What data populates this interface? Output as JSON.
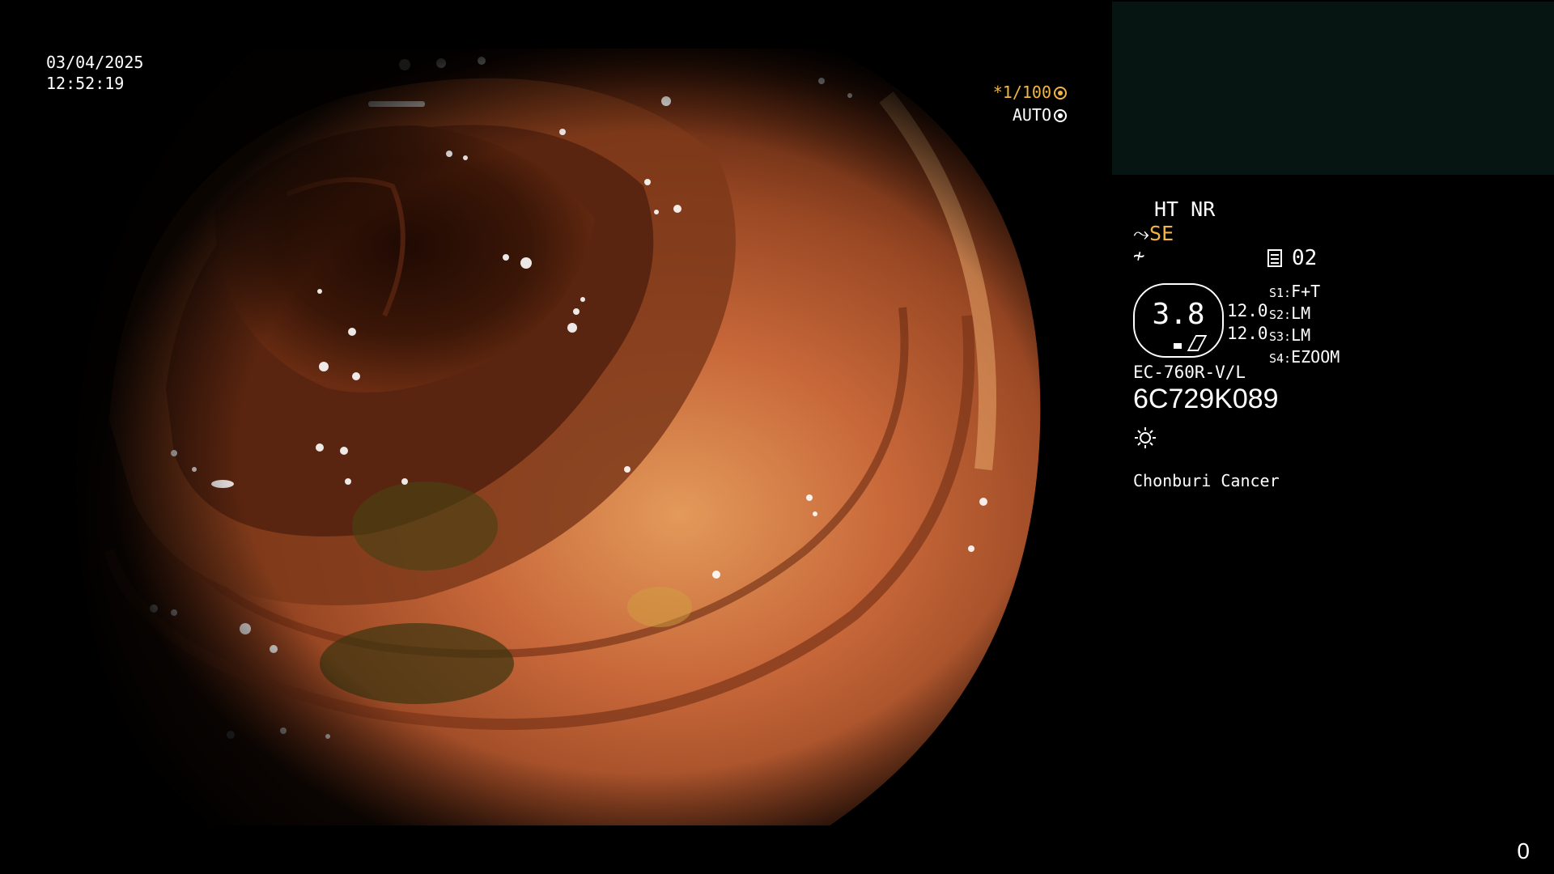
{
  "overlay": {
    "date": "03/04/2025",
    "time": "12:52:19",
    "shutter": "*1/100",
    "iris_mode": "AUTO"
  },
  "panel": {
    "enhancement": "HT NR",
    "structure_mode": "SE",
    "page_number": "02",
    "gauge_value": "3.8",
    "gauge_value_top": "12.0",
    "gauge_value_bottom": "12.0",
    "switches": [
      {
        "key": "S1:",
        "value": "F+T"
      },
      {
        "key": "S2:",
        "value": "LM"
      },
      {
        "key": "S3:",
        "value": "LM"
      },
      {
        "key": "S4:",
        "value": "EZOOM"
      }
    ],
    "scope_model": "EC-760R-V/L",
    "scope_serial": "6C729K089",
    "facility": "Chonburi Cancer"
  },
  "corner_counter": "0",
  "colors": {
    "accent_yellow": "#f2b640",
    "thumbnail_bg": "#061512",
    "mucosa": "#c8683a"
  }
}
